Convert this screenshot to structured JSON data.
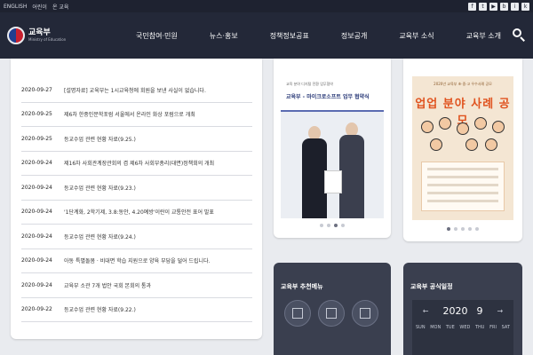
{
  "topbar": {
    "languages": [
      "ENGLISH",
      "어린이",
      "온 교육"
    ],
    "social": [
      "f",
      "t",
      "▶",
      "b",
      "i",
      "k"
    ]
  },
  "header": {
    "logo_name": "교육부",
    "logo_sub": "Ministry of Education",
    "nav": [
      "국민참여·민원",
      "뉴스·홍보",
      "정책정보공표",
      "정보공개",
      "교육부 소식",
      "교육부 소개"
    ]
  },
  "list": [
    {
      "date": "2020-09-27",
      "title": "[설명자료] 교육부는 1시교육청에 회원을 보낸 사실이 없습니다."
    },
    {
      "date": "2020-09-25",
      "title": "제6차 한중인문학포럼 서울에서 온라인 화상 포럼으로 개최"
    },
    {
      "date": "2020-09-25",
      "title": "등교수업 관련 현황 자료(9.25.)"
    },
    {
      "date": "2020-09-24",
      "title": "제16차 사회관계장관회의 겸 제6차 사회부총리(대면)정책회의 개최"
    },
    {
      "date": "2020-09-24",
      "title": "등교수업 관련 현황 자료(9.23.)"
    },
    {
      "date": "2020-09-24",
      "title": "'1단계화, 2학기제, 3.8:동안, 4.20예방'이란이 교통안전 표어 발표"
    },
    {
      "date": "2020-09-24",
      "title": "등교수업 관련 현황 자료(9.24.)"
    },
    {
      "date": "2020-09-24",
      "title": "아동 특별돌봄 · 비대면 학습 지원으로 양육 부담을 덜어 드립니다."
    },
    {
      "date": "2020-09-24",
      "title": "교육부 소관 7개 법안 국회 본회의 통과"
    },
    {
      "date": "2020-09-22",
      "title": "등교수업 관련 현황 자료(9.22.)"
    }
  ],
  "card1": {
    "banner_small": "교육 분야 디지털 전환 업무협약",
    "banner_title": "교육부 - 마이크로소프트 업무 협약식"
  },
  "card2": {
    "top_text": "2020년 교육부 초·중·고 우수사례 공모",
    "headline": "업업 분야 사례 공모"
  },
  "recommend": {
    "title": "교육부 추천메뉴"
  },
  "schedule": {
    "title": "교육부 공식일정",
    "year": "2020",
    "month": "9",
    "prev": "←",
    "next": "→",
    "weekdays": [
      "SUN",
      "MON",
      "TUE",
      "WED",
      "THU",
      "FRI",
      "SAT"
    ]
  },
  "colors": {
    "header_bg": "#232838",
    "panel_dark": "#3a3f4f",
    "accent_orange": "#e0531f"
  }
}
